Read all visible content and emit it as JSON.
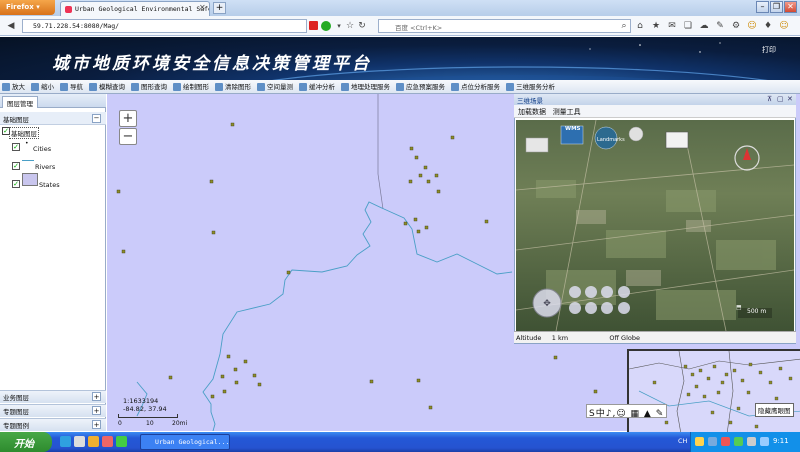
{
  "browser": {
    "app_button": "Firefox",
    "tab_title": "Urban Geological Environmental Safe···",
    "url": "59.71.228.54:8080/Mag/",
    "search_engine": "百度",
    "search_placeholder": "<Ctrl+K>"
  },
  "banner": {
    "title": "城市地质环境安全信息决策管理平台",
    "print_label": "打印"
  },
  "toolbar": {
    "items": [
      "放大",
      "缩小",
      "导航",
      "模糊查询",
      "图形查询",
      "绘制图形",
      "清除图形",
      "空间量测",
      "缓冲分析",
      "地理处理服务",
      "应急预案服务",
      "点位分析服务",
      "三维服务分析"
    ]
  },
  "left_panel": {
    "tab": "图层管理",
    "base_section": "基础图层",
    "root_layer": "基础图层",
    "layers": [
      {
        "name": "Cities",
        "checked": true
      },
      {
        "name": "Rivers",
        "checked": true
      },
      {
        "name": "States",
        "checked": true
      }
    ],
    "bottom_sections": [
      "业务图层",
      "专题图层",
      "专题图例"
    ]
  },
  "map": {
    "zoom_in": "+",
    "zoom_out": "−",
    "scale": "1:1633194",
    "coords": "-84.82, 37.94",
    "scale_ticks": [
      "0",
      "10",
      "20mi"
    ],
    "colors": {
      "background": "#cbcbfa",
      "river": "#4a9fc6",
      "city": "#8c8c2a"
    }
  },
  "panel3d": {
    "title": "三维场景",
    "tools": [
      "加载数据",
      "测量工具"
    ],
    "status": {
      "altitude_label": "Altitude",
      "altitude_value": "1 km",
      "globe_state": "Off Globe"
    },
    "scale_label": "500 m",
    "overlay_labels": [
      "WMS",
      "Landmarks"
    ]
  },
  "overview": {
    "hide_button": "隐藏鹰眼图"
  },
  "ime": {
    "text": "S中♪,☺ ▦ ▲ ✎"
  },
  "taskbar": {
    "start": "开始",
    "window_label": "Urban Geological...",
    "lang": "CH",
    "time": "9:11"
  }
}
